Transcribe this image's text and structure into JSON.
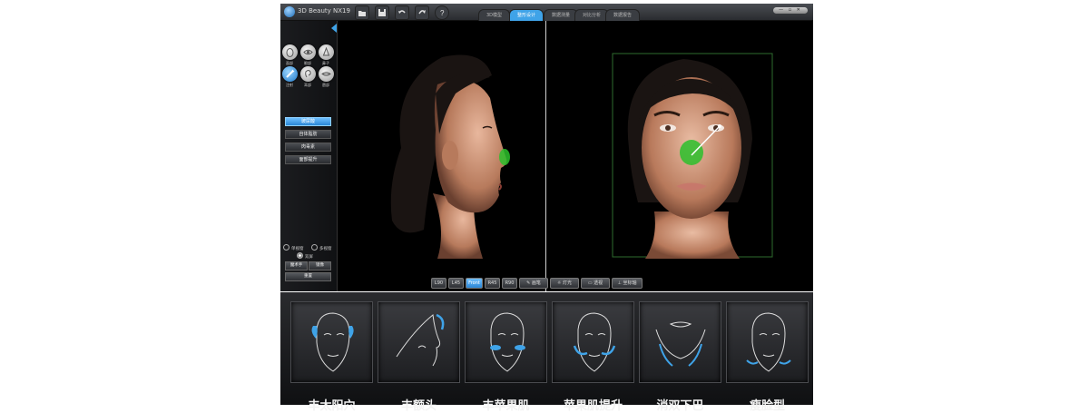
{
  "app": {
    "title": "3D Beauty NX19",
    "tabs": [
      {
        "label": "3D模型",
        "active": false
      },
      {
        "label": "整形设计",
        "active": true
      },
      {
        "label": "数据测量",
        "active": false
      },
      {
        "label": "对比分析",
        "active": false
      },
      {
        "label": "数据报告",
        "active": false
      }
    ],
    "window_controls": "— ▫ ✕",
    "accent_color": "#3fa3e8"
  },
  "toolbar": {
    "icons": [
      "folder-icon",
      "save-icon",
      "undo-icon",
      "redo-icon",
      "help-icon"
    ]
  },
  "sidebar": {
    "features": [
      {
        "label": "面部",
        "icon": "face-icon",
        "selected": false
      },
      {
        "label": "眼部",
        "icon": "eye-icon",
        "selected": false
      },
      {
        "label": "鼻子",
        "icon": "nose-icon",
        "selected": false
      },
      {
        "label": "注射",
        "icon": "syringe-icon",
        "selected": true
      },
      {
        "label": "耳部",
        "icon": "ear-icon",
        "selected": false
      },
      {
        "label": "唇部",
        "icon": "lips-icon",
        "selected": false
      }
    ],
    "procedures": [
      {
        "label": "玻尿酸",
        "selected": true
      },
      {
        "label": "自体脂肪",
        "selected": false
      },
      {
        "label": "肉毒素",
        "selected": false
      },
      {
        "label": "面部提升",
        "selected": false
      }
    ],
    "view_modes": {
      "single": "单视窗",
      "multi": "多视窗",
      "dual": "双屏"
    },
    "buttons": {
      "magic": "魔术手",
      "mirror": "镜像",
      "reset": "重置"
    }
  },
  "viewbar": {
    "angles": [
      {
        "label": "L90",
        "active": false
      },
      {
        "label": "L45",
        "active": false
      },
      {
        "label": "Front",
        "active": true
      },
      {
        "label": "R45",
        "active": false
      },
      {
        "label": "R90",
        "active": false
      }
    ],
    "tools": [
      {
        "label": "画笔",
        "icon": "pen-icon"
      },
      {
        "label": "灯光",
        "icon": "light-icon"
      },
      {
        "label": "透视",
        "icon": "perspective-icon"
      },
      {
        "label": "坐标轴",
        "icon": "axis-icon"
      }
    ]
  },
  "treatments": [
    {
      "label": "丰太阳穴",
      "icon": "temple-icon"
    },
    {
      "label": "丰额头",
      "icon": "forehead-icon"
    },
    {
      "label": "丰苹果肌",
      "icon": "cheek-icon"
    },
    {
      "label": "苹果肌提升",
      "icon": "cheek-lift-icon"
    },
    {
      "label": "消双下巴",
      "icon": "double-chin-icon"
    },
    {
      "label": "瘦脸型",
      "icon": "slim-face-icon"
    }
  ]
}
